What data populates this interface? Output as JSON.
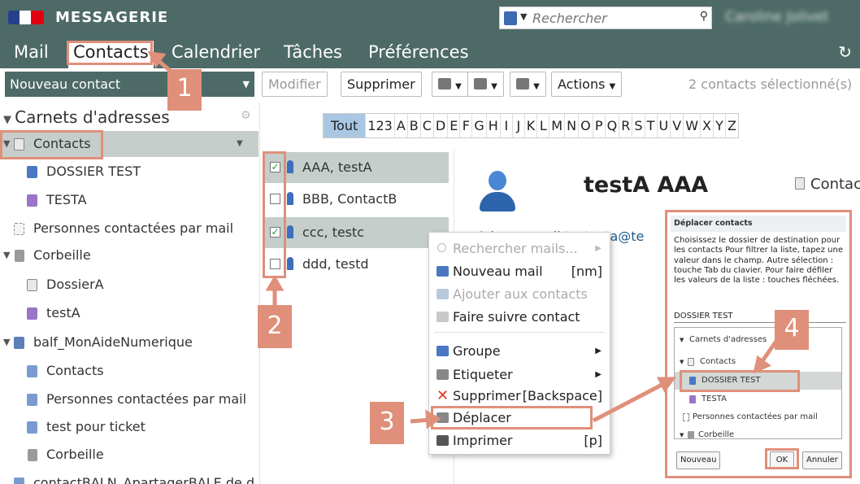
{
  "header": {
    "app_title": "MESSAGERIE",
    "search_placeholder": "Rechercher",
    "user_name": "Caroline Jolivet"
  },
  "nav": {
    "tabs": [
      "Mail",
      "Contacts",
      "Calendrier",
      "Tâches",
      "Préférences"
    ],
    "active_tab": "Contacts"
  },
  "toolbar": {
    "new_contact": "Nouveau contact",
    "edit": "Modifier",
    "delete": "Supprimer",
    "actions": "Actions",
    "selection_status": "2 contacts sélectionné(s)"
  },
  "address_books": {
    "title": "Carnets d'adresses",
    "items": [
      {
        "label": "Contacts",
        "icon": "address-book-icon",
        "selected": true
      },
      {
        "label": "DOSSIER TEST",
        "icon": "contact-folder-icon"
      },
      {
        "label": "TESTA",
        "icon": "contact-folder-icon"
      },
      {
        "label": "Personnes contactées par mail",
        "icon": "address-book-icon"
      },
      {
        "label": "Corbeille",
        "icon": "trash-icon"
      },
      {
        "label": "DossierA",
        "icon": "address-book-icon"
      },
      {
        "label": "testA",
        "icon": "contact-folder-icon"
      },
      {
        "label": "balf_MonAideNumerique",
        "icon": "shared-mailbox-icon"
      },
      {
        "label": "Contacts",
        "icon": "shared-book-icon"
      },
      {
        "label": "Personnes contactées par mail",
        "icon": "shared-book-icon"
      },
      {
        "label": "test pour ticket",
        "icon": "shared-book-icon"
      },
      {
        "label": "Corbeille",
        "icon": "trash-icon"
      },
      {
        "label": "contactBALN_ApartagerBALE de d",
        "icon": "shared-book-icon"
      }
    ]
  },
  "alphabet": [
    "Tout",
    "123",
    "A",
    "B",
    "C",
    "D",
    "E",
    "F",
    "G",
    "H",
    "I",
    "J",
    "K",
    "L",
    "M",
    "N",
    "O",
    "P",
    "Q",
    "R",
    "S",
    "T",
    "U",
    "V",
    "W",
    "X",
    "Y",
    "Z"
  ],
  "contacts": [
    {
      "name": "AAA, testA",
      "checked": true
    },
    {
      "name": "BBB, ContactB",
      "checked": false
    },
    {
      "name": "ccc, testc",
      "checked": true
    },
    {
      "name": "ddd, testd",
      "checked": false
    }
  ],
  "detail": {
    "name": "testA AAA",
    "book": "Contacts",
    "email_label": "Adresse mail",
    "email": "testacta@te"
  },
  "context_menu": {
    "items": [
      {
        "label": "Rechercher mails...",
        "disabled": true,
        "submenu": true
      },
      {
        "label": "Nouveau mail",
        "shortcut": "[nm]"
      },
      {
        "label": "Ajouter aux contacts",
        "disabled": true
      },
      {
        "label": "Faire suivre contact"
      },
      {
        "label": "Groupe",
        "submenu": true
      },
      {
        "label": "Etiqueter",
        "submenu": true
      },
      {
        "label": "Supprimer",
        "shortcut": "[Backspace]"
      },
      {
        "label": "Déplacer"
      },
      {
        "label": "Imprimer",
        "shortcut": "[p]"
      }
    ]
  },
  "move_dialog": {
    "title": "Déplacer contacts",
    "help": "Choisissez le dossier de destination pour les contacts Pour filtrer la liste, tapez une valeur dans le champ. Autre sélection : touche Tab du clavier. Pour faire défiler les valeurs de la liste : touches fléchées.",
    "value": "DOSSIER TEST",
    "tree": [
      "Carnets d'adresses",
      "Contacts",
      "DOSSIER TEST",
      "TESTA",
      "Personnes contactées par mail",
      "Corbeille"
    ],
    "buttons": {
      "new": "Nouveau",
      "ok": "OK",
      "cancel": "Annuler"
    }
  },
  "annotations": [
    "1",
    "2",
    "3",
    "4"
  ],
  "colors": {
    "header": "#4d6a66",
    "highlight": "#e08f7a",
    "selection": "#c5ceca",
    "alpha_active": "#a9c7e2"
  }
}
